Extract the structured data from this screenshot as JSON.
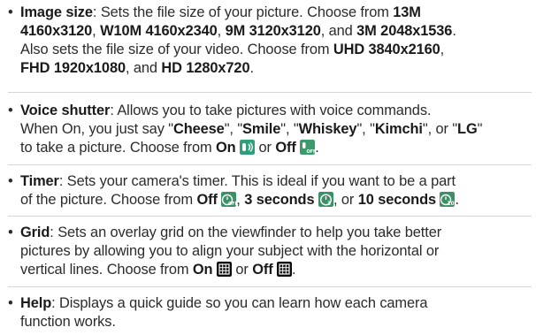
{
  "bullet": "•",
  "items": [
    {
      "title": "Image size",
      "lines": [
        [
          {
            "t": "",
            "s": ": Sets the file size of your picture. Choose from "
          },
          {
            "b": "13M"
          }
        ],
        [
          {
            "b": "4160x3120"
          },
          {
            "s": ", "
          },
          {
            "b": "W10M 4160x2340"
          },
          {
            "s": ", "
          },
          {
            "b": "9M 3120x3120"
          },
          {
            "s": ", and "
          },
          {
            "b": "3M 2048x1536"
          },
          {
            "s": "."
          }
        ],
        [
          {
            "s": "Also sets the file size of your video. Choose from "
          },
          {
            "b": "UHD 3840x2160"
          },
          {
            "s": ","
          }
        ],
        [
          {
            "b": "FHD 1920x1080"
          },
          {
            "s": ", and "
          },
          {
            "b": "HD 1280x720"
          },
          {
            "s": "."
          }
        ]
      ]
    },
    {
      "title": "Voice shutter",
      "lines": [
        [
          {
            "s": ": Allows you to take pictures with voice commands."
          }
        ],
        [
          {
            "s": "When On, you just say \""
          },
          {
            "b": "Cheese"
          },
          {
            "s": "\", \""
          },
          {
            "b": "Smile"
          },
          {
            "s": "\", \""
          },
          {
            "b": "Whiskey"
          },
          {
            "s": "\", \""
          },
          {
            "b": "Kimchi"
          },
          {
            "s": "\", or \""
          },
          {
            "b": "LG"
          },
          {
            "s": "\""
          }
        ],
        [
          {
            "s": "to take a picture. Choose from "
          },
          {
            "b": "On"
          },
          {
            "s": " "
          },
          {
            "icon": "voice-shutter-on-icon"
          },
          {
            "s": " or "
          },
          {
            "b": "Off"
          },
          {
            "s": " "
          },
          {
            "icon": "voice-shutter-off-icon"
          },
          {
            "s": "."
          }
        ]
      ]
    },
    {
      "title": "Timer",
      "lines": [
        [
          {
            "s": ": Sets your camera's timer. This is ideal if you want to be a part"
          }
        ],
        [
          {
            "s": "of the picture. Choose from "
          },
          {
            "b": "Off"
          },
          {
            "s": " "
          },
          {
            "icon": "timer-off-icon"
          },
          {
            "s": ", "
          },
          {
            "b": "3 seconds"
          },
          {
            "s": " "
          },
          {
            "icon": "timer-3s-icon"
          },
          {
            "s": ", or "
          },
          {
            "b": "10 seconds"
          },
          {
            "s": " "
          },
          {
            "icon": "timer-10s-icon"
          },
          {
            "s": "."
          }
        ]
      ]
    },
    {
      "title": "Grid",
      "lines": [
        [
          {
            "s": ": Sets an overlay grid on the viewfinder to help you take better"
          }
        ],
        [
          {
            "s": "pictures by allowing you to align your subject with the horizontal or"
          }
        ],
        [
          {
            "s": "vertical lines. Choose from "
          },
          {
            "b": "On"
          },
          {
            "s": " "
          },
          {
            "icon": "grid-on-icon"
          },
          {
            "s": " or "
          },
          {
            "b": "Off"
          },
          {
            "s": " "
          },
          {
            "icon": "grid-off-icon"
          },
          {
            "s": "."
          }
        ]
      ]
    },
    {
      "title": "Help",
      "lines": [
        [
          {
            "s": ": Displays a quick guide so you can learn how each camera"
          }
        ],
        [
          {
            "s": "function works."
          }
        ]
      ]
    }
  ],
  "colors": {
    "text": "#2b2b2b",
    "divider": "#d6d6d6",
    "icon_voice_on": "#2f9e7a",
    "icon_voice_off": "#3c9a6c",
    "icon_timer": "#3c8f66",
    "icon_grid": "#0b0b0b"
  }
}
